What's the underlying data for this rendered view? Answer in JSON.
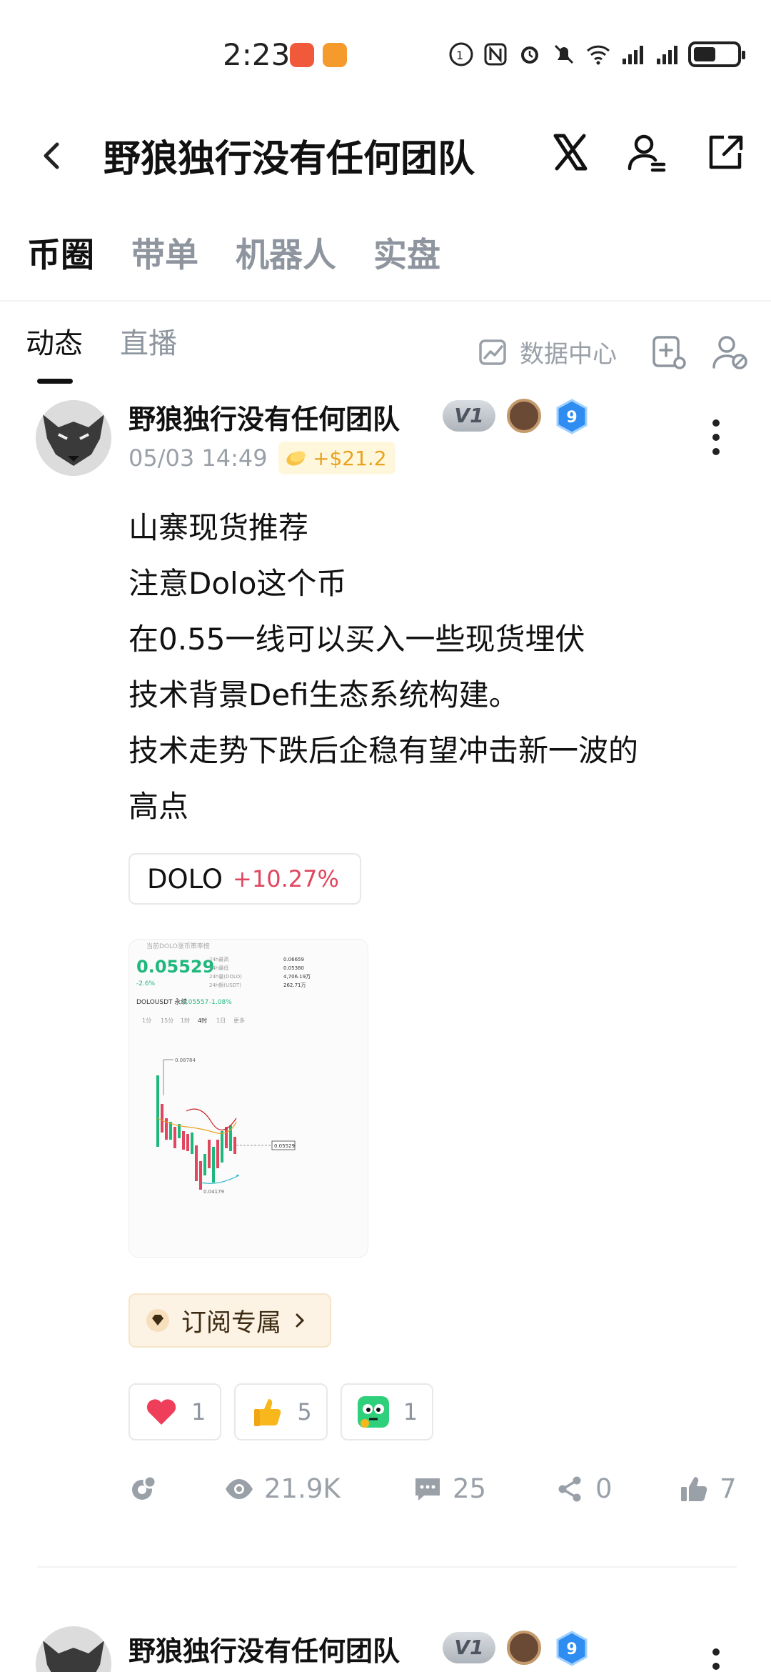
{
  "status_bar": {
    "time": "2:23"
  },
  "header": {
    "title": "野狼独行没有任何团队"
  },
  "category_tabs": [
    {
      "label": "币圈",
      "active": true
    },
    {
      "label": "带单",
      "active": false
    },
    {
      "label": "机器人",
      "active": false
    },
    {
      "label": "实盘",
      "active": false
    }
  ],
  "sub_tabs": [
    {
      "label": "动态",
      "active": true
    },
    {
      "label": "直播",
      "active": false
    }
  ],
  "toolbar": {
    "data_center_label": "数据中心"
  },
  "post": {
    "author": "野狼独行没有任何团队",
    "level_badge": "V1",
    "rank_badge": "9",
    "timestamp": "05/03 14:49",
    "profit": "+$21.2",
    "lines": [
      "山寨现货推荐",
      "注意Dolo这个币",
      "在0.55一线可以买入一些现货埋伏",
      "技术背景Defi生态系统构建。",
      "技术走势下跌后企稳有望冲击新一波的",
      "高点"
    ],
    "coin": {
      "symbol": "DOLO",
      "change": "+10.27%"
    },
    "chart_image": {
      "header": "当前DOLO涨币策率榜",
      "price": "0.05529",
      "change": "-2.6%",
      "stats": [
        {
          "label": "24h最高",
          "value": "0.06659"
        },
        {
          "label": "24h最低",
          "value": "0.05380"
        },
        {
          "label": "24h量(DOLO)",
          "value": "4,706.19万"
        },
        {
          "label": "24h额(USDT)",
          "value": "262.71万"
        }
      ],
      "pair": "DOLOUSDT 永续",
      "pair_price": "0.05557",
      "pair_change": "-1.08%",
      "timeframes": [
        "1分",
        "15分",
        "1时",
        "4时",
        "1日",
        "更多"
      ],
      "high_label": "0.08784",
      "low_label": "0.04179",
      "last_label": "0.05529"
    },
    "subscribe_label": "订阅专属",
    "reactions": [
      {
        "icon": "heart-icon",
        "count": "1"
      },
      {
        "icon": "thumbs-up-emoji-icon",
        "count": "5"
      },
      {
        "icon": "thinking-face-icon",
        "count": "1"
      }
    ],
    "stats": {
      "views": "21.9K",
      "comments": "25",
      "shares": "0",
      "likes": "7"
    }
  },
  "next_post": {
    "author": "野狼独行没有任何团队",
    "level_badge": "V1",
    "rank_badge": "9"
  },
  "colors": {
    "accent_red": "#e0465e",
    "profit_gold": "#e8a21c",
    "muted_gray": "#9aa0a8",
    "chart_green": "#1fb87c"
  }
}
